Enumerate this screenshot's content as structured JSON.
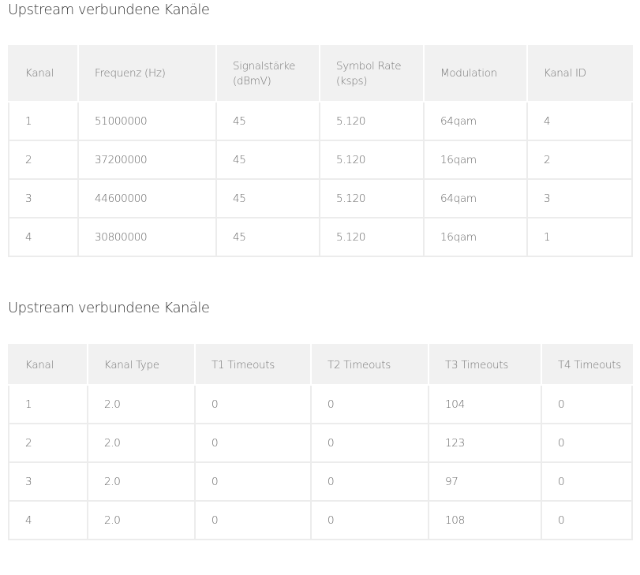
{
  "section1": {
    "title": "Upstream verbundene Kanäle",
    "columns": [
      "Kanal",
      "Frequenz (Hz)",
      "Signalstärke (dBmV)",
      "Symbol Rate (ksps)",
      "Modulation",
      "Kanal ID"
    ],
    "rows": [
      [
        "1",
        "51000000",
        "45",
        "5.120",
        "64qam",
        "4"
      ],
      [
        "2",
        "37200000",
        "45",
        "5.120",
        "16qam",
        "2"
      ],
      [
        "3",
        "44600000",
        "45",
        "5.120",
        "64qam",
        "3"
      ],
      [
        "4",
        "30800000",
        "45",
        "5.120",
        "16qam",
        "1"
      ]
    ]
  },
  "section2": {
    "title": "Upstream verbundene Kanäle",
    "columns": [
      "Kanal",
      "Kanal Type",
      "T1 Timeouts",
      "T2 Timeouts",
      "T3 Timeouts",
      "T4 Timeouts"
    ],
    "rows": [
      [
        "1",
        "2.0",
        "0",
        "0",
        "104",
        "0"
      ],
      [
        "2",
        "2.0",
        "0",
        "0",
        "123",
        "0"
      ],
      [
        "3",
        "2.0",
        "0",
        "0",
        "97",
        "0"
      ],
      [
        "4",
        "2.0",
        "0",
        "0",
        "108",
        "0"
      ]
    ]
  }
}
